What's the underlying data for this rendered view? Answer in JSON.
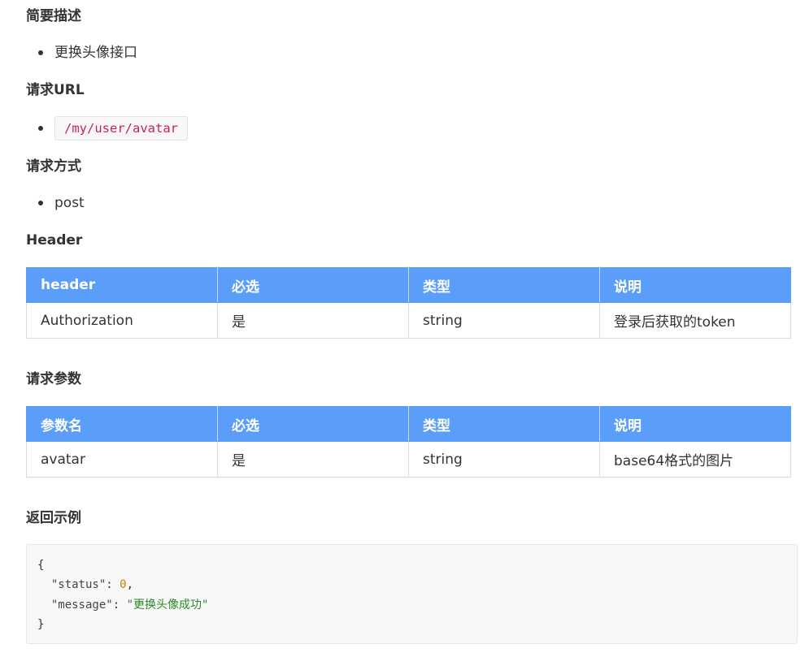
{
  "description": {
    "title": "简要描述",
    "items": [
      "更换头像接口"
    ]
  },
  "url": {
    "title": "请求URL",
    "code": "/my/user/avatar"
  },
  "method": {
    "title": "请求方式",
    "items": [
      "post"
    ]
  },
  "header_section": {
    "title": "Header",
    "table": {
      "columns": [
        "header",
        "必选",
        "类型",
        "说明"
      ],
      "rows": [
        [
          "Authorization",
          "是",
          "string",
          "登录后获取的token"
        ]
      ]
    }
  },
  "params_section": {
    "title": "请求参数",
    "table": {
      "columns": [
        "参数名",
        "必选",
        "类型",
        "说明"
      ],
      "rows": [
        [
          "avatar",
          "是",
          "string",
          "base64格式的图片"
        ]
      ]
    }
  },
  "response": {
    "title": "返回示例",
    "code": {
      "open": "{",
      "entries": [
        {
          "key": "\"status\"",
          "separator": ": ",
          "value": "0",
          "trailing": ","
        },
        {
          "key": "\"message\"",
          "separator": ": ",
          "value": "\"更换头像成功\"",
          "trailing": ""
        }
      ],
      "close": "}"
    }
  },
  "colors": {
    "text": "#333333",
    "accent": "#5b9ef9",
    "inline_code": "#c7254e",
    "code_key": "#444444",
    "code_number": "#c18401",
    "code_string": "#2a8a2a"
  }
}
